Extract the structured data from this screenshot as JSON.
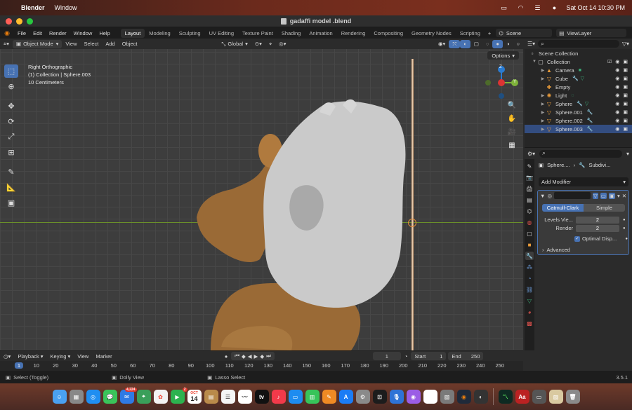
{
  "menubar": {
    "app": "Blender",
    "window_menu": "Window",
    "datetime": "Sat Oct 14  10:30 PM"
  },
  "window": {
    "title": "gadaffi model .blend"
  },
  "topbar": {
    "menus": [
      "File",
      "Edit",
      "Render",
      "Window",
      "Help"
    ],
    "workspaces": [
      "Layout",
      "Modeling",
      "Sculpting",
      "UV Editing",
      "Texture Paint",
      "Shading",
      "Animation",
      "Rendering",
      "Compositing",
      "Geometry Nodes",
      "Scripting"
    ],
    "active_workspace": "Layout",
    "scene": "Scene",
    "view_layer": "ViewLayer"
  },
  "viewport_header": {
    "mode": "Object Mode",
    "menus": [
      "View",
      "Select",
      "Add",
      "Object"
    ],
    "transform_orientation": "Global",
    "options": "Options"
  },
  "viewport": {
    "info_lines": [
      "Right Orthographic",
      "(1) Collection | Sphere.003",
      "10 Centimeters"
    ]
  },
  "gizmo": {
    "z": "Z",
    "y": "Y"
  },
  "outliner": {
    "scene_collection": "Scene Collection",
    "collection": "Collection",
    "items": [
      {
        "label": "Camera",
        "icon": "camera-icon"
      },
      {
        "label": "Cube",
        "icon": "mesh-icon"
      },
      {
        "label": "Empty",
        "icon": "empty-icon"
      },
      {
        "label": "Light",
        "icon": "light-icon"
      },
      {
        "label": "Sphere",
        "icon": "mesh-icon"
      },
      {
        "label": "Sphere.001",
        "icon": "mesh-icon"
      },
      {
        "label": "Sphere.002",
        "icon": "mesh-icon"
      },
      {
        "label": "Sphere.003",
        "icon": "mesh-icon"
      }
    ]
  },
  "properties": {
    "object": "Sphere....",
    "modifier_short": "Subdivi...",
    "add_modifier": "Add Modifier",
    "mode_catmull": "Catmull-Clark",
    "mode_simple": "Simple",
    "levels_label": "Levels Vie...",
    "levels_value": "2",
    "render_label": "Render",
    "render_value": "2",
    "optimal_display": "Optimal Disp...",
    "advanced": "Advanced"
  },
  "timeline": {
    "menus": [
      "Playback",
      "Keying",
      "View",
      "Marker"
    ],
    "current_frame": "1",
    "start_label": "Start",
    "start_value": "1",
    "end_label": "End",
    "end_value": "250",
    "ticks": [
      "1",
      "10",
      "20",
      "30",
      "40",
      "50",
      "60",
      "70",
      "80",
      "90",
      "100",
      "110",
      "120",
      "130",
      "140",
      "150",
      "160",
      "170",
      "180",
      "190",
      "200",
      "210",
      "220",
      "230",
      "240",
      "250"
    ]
  },
  "statusbar": {
    "left": "Select (Toggle)",
    "middle": "Dolly View",
    "right_hint": "Lasso Select",
    "version": "3.5.1"
  },
  "dock": {
    "mail_badge": "4,224",
    "calendar_month": "OCT",
    "calendar_day": "14",
    "badge_2": "2",
    "dictionary_label": "Aa"
  },
  "colors": {
    "accent": "#4772b3",
    "head_gray": "#c9c9c9",
    "body_brown": "#9a6a36",
    "blender_orange": "#e87d0d"
  }
}
